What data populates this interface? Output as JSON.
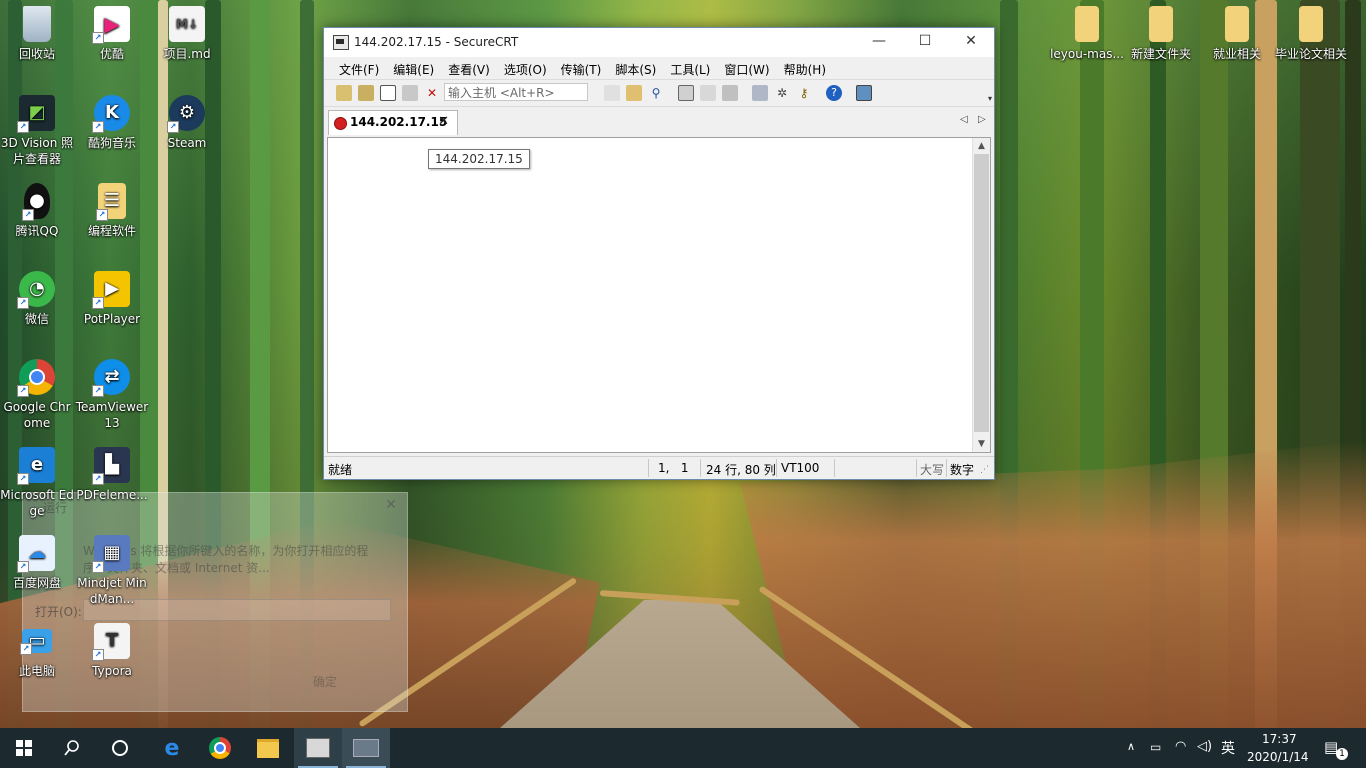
{
  "desktop_icons": [
    {
      "label": "回收站",
      "icon": "recycle-bin-icon"
    },
    {
      "label": "优酷",
      "icon": "youku-icon"
    },
    {
      "label": "项目.md",
      "icon": "markdown-file-icon"
    },
    {
      "label": "3D Vision 照片查看器",
      "icon": "3d-vision-icon"
    },
    {
      "label": "酷狗音乐",
      "icon": "kugou-icon"
    },
    {
      "label": "Steam",
      "icon": "steam-icon"
    },
    {
      "label": "腾讯QQ",
      "icon": "qq-icon"
    },
    {
      "label": "编程软件",
      "icon": "folder-shortcut-icon"
    },
    {
      "label": "微信",
      "icon": "wechat-icon"
    },
    {
      "label": "PotPlayer",
      "icon": "potplayer-icon"
    },
    {
      "label": "Google Chrome",
      "icon": "chrome-icon"
    },
    {
      "label": "TeamViewer 13",
      "icon": "teamviewer-icon"
    },
    {
      "label": "Microsoft Edge",
      "icon": "edge-icon"
    },
    {
      "label": "PDFeleme...",
      "icon": "pdfelement-icon"
    },
    {
      "label": "百度网盘",
      "icon": "baidu-netdisk-icon"
    },
    {
      "label": "Mindjet MindMan...",
      "icon": "mindmanager-icon"
    },
    {
      "label": "此电脑",
      "icon": "this-pc-icon"
    },
    {
      "label": "Typora",
      "icon": "typora-icon"
    },
    {
      "label": "leyou-mas...",
      "icon": "folder-icon"
    },
    {
      "label": "新建文件夹",
      "icon": "folder-icon"
    },
    {
      "label": "就业相关",
      "icon": "folder-icon"
    },
    {
      "label": "毕业论文相关",
      "icon": "folder-icon"
    }
  ],
  "run_dialog": {
    "title": "运行",
    "description": "Windows 将根据你所键入的名称，为你打开相应的程序、文件夹、文档或 Internet 资...",
    "open_label": "打开(O):",
    "ok_label": "确定"
  },
  "securecrt": {
    "title": "144.202.17.15 - SecureCRT",
    "menu": [
      "文件(F)",
      "编辑(E)",
      "查看(V)",
      "选项(O)",
      "传输(T)",
      "脚本(S)",
      "工具(L)",
      "窗口(W)",
      "帮助(H)"
    ],
    "host_placeholder": "输入主机 <Alt+R>",
    "tab_label": "144.202.17.15",
    "tooltip": "144.202.17.15",
    "status": {
      "ready": "就绪",
      "cursor": "1,   1",
      "size": "24 行, 80 列",
      "emulation": "VT100",
      "caps": "大写",
      "num": "数字"
    }
  },
  "taskbar": {
    "time": "17:37",
    "date": "2020/1/14",
    "ime": "英",
    "notification_count": "1"
  }
}
